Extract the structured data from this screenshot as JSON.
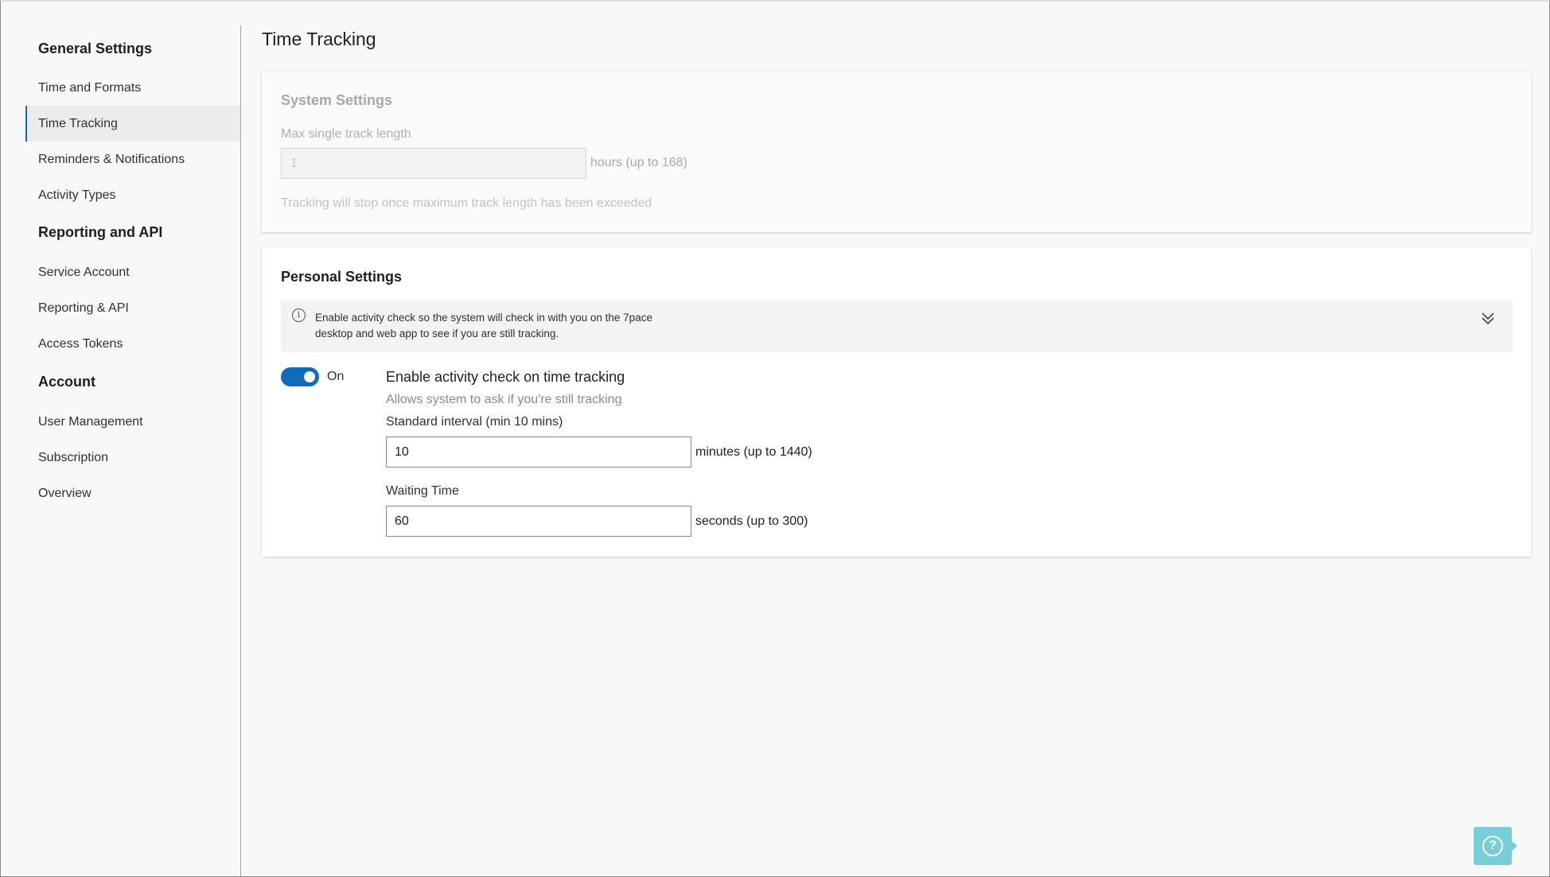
{
  "sidebar": {
    "groups": [
      {
        "title": "General Settings",
        "items": [
          "Time and Formats",
          "Time Tracking",
          "Reminders & Notifications",
          "Activity Types"
        ]
      },
      {
        "title": "Reporting and API",
        "items": [
          "Service Account",
          "Reporting & API",
          "Access Tokens"
        ]
      },
      {
        "title": "Account",
        "items": [
          "User Management",
          "Subscription",
          "Overview"
        ]
      }
    ],
    "active_item": "Time Tracking"
  },
  "page": {
    "title": "Time Tracking"
  },
  "system_settings": {
    "title": "System Settings",
    "max_track_label": "Max single track length",
    "max_track_value": "1",
    "max_track_unit": "hours (up to 168)",
    "hint": "Tracking will stop once maximum track length has been exceeded"
  },
  "personal_settings": {
    "title": "Personal Settings",
    "info_line1": "Enable activity check so the system will check in with you on the 7pace",
    "info_line2": "desktop and web app to see if you are still tracking.",
    "toggle_state": "On",
    "toggle_on": true,
    "option_title": "Enable activity check on time tracking",
    "option_desc": "Allows system to ask if you're still tracking",
    "interval_label": "Standard interval (min 10 mins)",
    "interval_value": "10",
    "interval_unit": "minutes (up to 1440)",
    "waiting_label": "Waiting Time",
    "waiting_value": "60",
    "waiting_unit": "seconds (up to 300)"
  },
  "icons": {
    "info": "info-icon",
    "chevron": "double-chevron-down-icon",
    "help": "help-question-icon"
  },
  "colors": {
    "accent": "#0f6cbd",
    "help_button": "#5fc7d3"
  }
}
